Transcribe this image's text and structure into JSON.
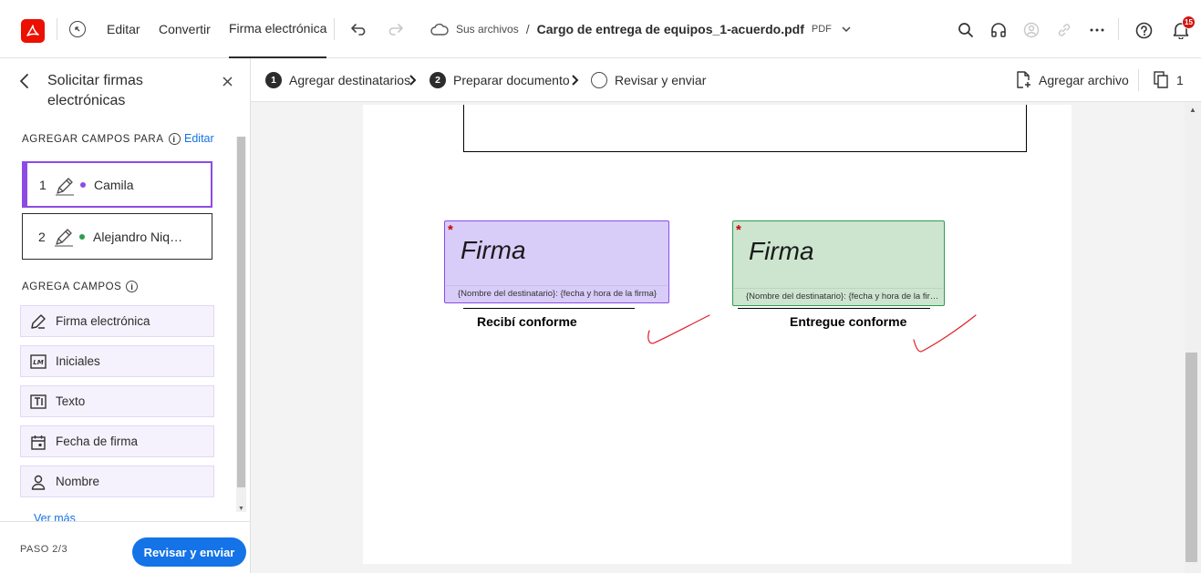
{
  "topbar": {
    "nav": [
      "Editar",
      "Convertir",
      "Firma electrónica"
    ],
    "active_nav": "Firma electrónica",
    "breadcrumb_root": "Sus archivos",
    "breadcrumb_sep": "/",
    "file_name": "Cargo de entrega de equipos_1-acuerdo.pdf",
    "file_type": "PDF",
    "notifications_count": "15"
  },
  "left_panel": {
    "title": "Solicitar firmas electrónicas",
    "add_fields_for_label": "AGREGAR CAMPOS PARA",
    "edit_link": "Editar",
    "recipients": [
      {
        "number": "1",
        "name": "Camila",
        "color": "#8c4be6",
        "selected": true
      },
      {
        "number": "2",
        "name": "Alejandro Niquén",
        "color": "#2d9d4f",
        "selected": false
      }
    ],
    "add_fields_label": "AGREGA CAMPOS",
    "fields": [
      {
        "label": "Firma electrónica",
        "icon": "signature-pen-icon"
      },
      {
        "label": "Iniciales",
        "icon": "initials-icon"
      },
      {
        "label": "Texto",
        "icon": "text-field-icon"
      },
      {
        "label": "Fecha de firma",
        "icon": "calendar-icon"
      },
      {
        "label": "Nombre",
        "icon": "person-icon"
      }
    ],
    "more_link": "Ver más",
    "step_label": "PASO 2/3",
    "primary_button": "Revisar y enviar"
  },
  "steps": [
    {
      "number": "1",
      "label": "Agregar destinatarios",
      "state": "done"
    },
    {
      "number": "2",
      "label": "Preparar documento",
      "state": "current"
    },
    {
      "number": "",
      "label": "Revisar y enviar",
      "state": "pending"
    }
  ],
  "step_actions": {
    "add_file": "Agregar archivo",
    "page_count": "1"
  },
  "document": {
    "signature_fields": [
      {
        "label": "Firma",
        "placeholder": "{Nombre del destinatario}: {fecha y hora de la firma}",
        "color": "#d8cdf9",
        "border": "#8c4be6"
      },
      {
        "label": "Firma",
        "placeholder": "{Nombre del destinatario}: {fecha y hora de la firma}",
        "color": "#cde5cf",
        "border": "#2d9d4f"
      }
    ],
    "captions": [
      "Recibí conforme",
      "Entregue conforme"
    ],
    "checkmark_color": "#e0202a"
  }
}
